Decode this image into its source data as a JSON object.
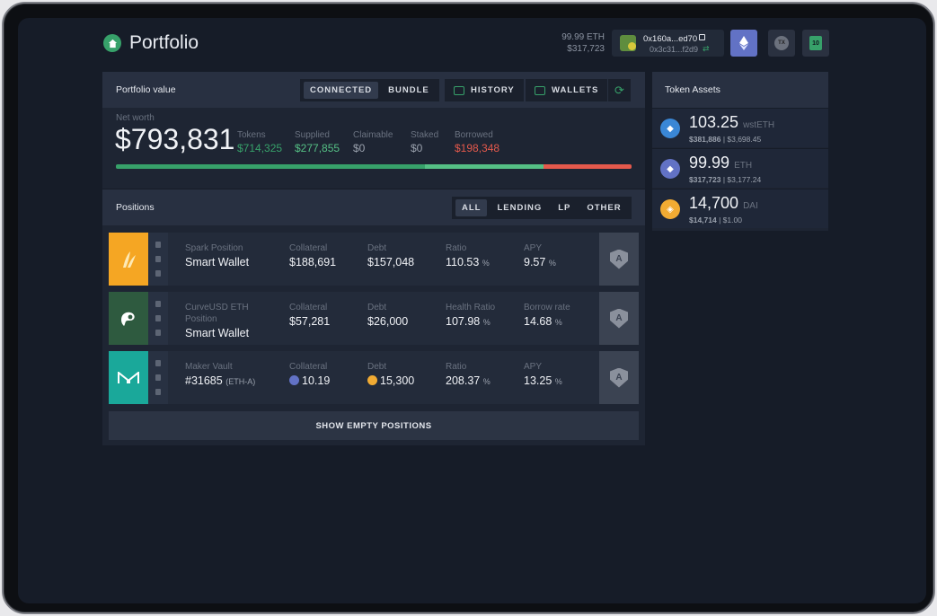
{
  "header": {
    "title": "Portfolio",
    "balance_eth": "99.99 ETH",
    "balance_usd": "$317,723",
    "wallet_address": "0x160a...ed70",
    "wallet_sub": "0x3c31...f2d9",
    "tx_label": "TX",
    "gift_label": "10"
  },
  "portfolio": {
    "title": "Portfolio value",
    "tabs": [
      "CONNECTED",
      "BUNDLE"
    ],
    "history_label": "HISTORY",
    "wallets_label": "WALLETS",
    "net_worth_label": "Net worth",
    "net_worth": "$793,831",
    "stats": [
      {
        "label": "Tokens",
        "value": "$714,325"
      },
      {
        "label": "Supplied",
        "value": "$277,855"
      },
      {
        "label": "Claimable",
        "value": "$0"
      },
      {
        "label": "Staked",
        "value": "$0"
      },
      {
        "label": "Borrowed",
        "value": "$198,348"
      }
    ],
    "bar_fractions": {
      "tokens": 0.6,
      "supplied": 0.23,
      "borrowed": 0.17
    }
  },
  "positions": {
    "title": "Positions",
    "filters": [
      "ALL",
      "LENDING",
      "LP",
      "OTHER"
    ],
    "rows": [
      {
        "type": "Spark Position",
        "name": "Smart Wallet",
        "c1k": "Collateral",
        "c1v": "$188,691",
        "c2k": "Debt",
        "c2v": "$157,048",
        "c3k": "Ratio",
        "c3v": "110.53",
        "c4k": "APY",
        "c4v": "9.57"
      },
      {
        "type": "CurveUSD ETH Position",
        "name": "Smart Wallet",
        "c1k": "Collateral",
        "c1v": "$57,281",
        "c2k": "Debt",
        "c2v": "$26,000",
        "c3k": "Health Ratio",
        "c3v": "107.98",
        "c4k": "Borrow rate",
        "c4v": "14.68"
      },
      {
        "type": "Maker Vault",
        "name": "#31685",
        "name_sub": "(ETH-A)",
        "c1k": "Collateral",
        "c1v": "10.19",
        "c2k": "Debt",
        "c2v": "15,300",
        "c3k": "Ratio",
        "c3v": "208.37",
        "c4k": "APY",
        "c4v": "13.25"
      }
    ],
    "percent_sign": "%",
    "show_empty_label": "SHOW EMPTY POSITIONS"
  },
  "token_assets": {
    "title": "Token Assets",
    "items": [
      {
        "amount": "103.25",
        "symbol": "wstETH",
        "usd": "$381,886",
        "price": "$3,698.45",
        "color": "#3a87d6"
      },
      {
        "amount": "99.99",
        "symbol": "ETH",
        "usd": "$317,723",
        "price": "$3,177.24",
        "color": "#6272c5"
      },
      {
        "amount": "14,700",
        "symbol": "DAI",
        "usd": "$14,714",
        "price": "$1.00",
        "color": "#f1ab33"
      }
    ]
  },
  "colors": {
    "accent": "#37a16a",
    "borrowed": "#e4594c",
    "spark": "#f5a623",
    "curve": "#2e5a3f",
    "maker": "#1aa89a"
  }
}
